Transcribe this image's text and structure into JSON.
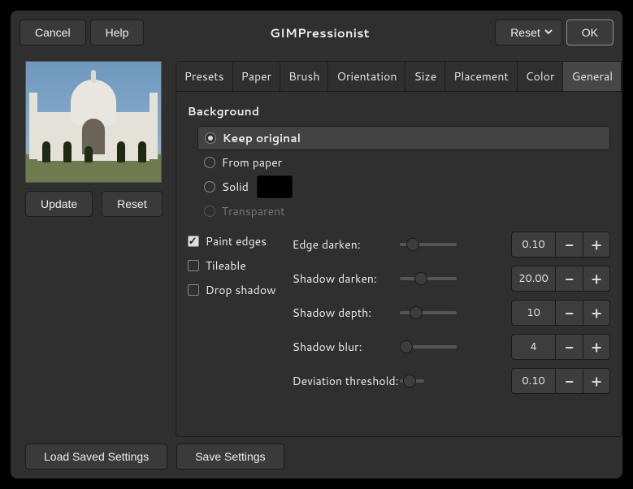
{
  "header": {
    "cancel": "Cancel",
    "help": "Help",
    "title": "GIMPressionist",
    "reset": "Reset",
    "ok": "OK"
  },
  "preview": {
    "update": "Update",
    "reset": "Reset"
  },
  "tabs": [
    "Presets",
    "Paper",
    "Brush",
    "Orientation",
    "Size",
    "Placement",
    "Color",
    "General"
  ],
  "active_tab": 7,
  "background": {
    "heading": "Background",
    "options": {
      "keep_original": "Keep original",
      "from_paper": "From paper",
      "solid": "Solid",
      "transparent": "Transparent"
    },
    "selected": "keep_original",
    "solid_color": "#000000"
  },
  "checks": {
    "paint_edges": {
      "label": "Paint edges",
      "checked": true
    },
    "tileable": {
      "label": "Tileable",
      "checked": false
    },
    "drop_shadow": {
      "label": "Drop shadow",
      "checked": false
    }
  },
  "sliders": {
    "edge_darken": {
      "label": "Edge darken:",
      "value": "0.10",
      "pos": 8
    },
    "shadow_darken": {
      "label": "Shadow darken:",
      "value": "20.00",
      "pos": 18
    },
    "shadow_depth": {
      "label": "Shadow depth:",
      "value": "10",
      "pos": 12
    },
    "shadow_blur": {
      "label": "Shadow blur:",
      "value": "4",
      "pos": 0
    },
    "deviation": {
      "label": "Deviation threshold:",
      "value": "0.10",
      "pos": 4
    }
  },
  "footer": {
    "load": "Load Saved Settings",
    "save": "Save Settings"
  }
}
